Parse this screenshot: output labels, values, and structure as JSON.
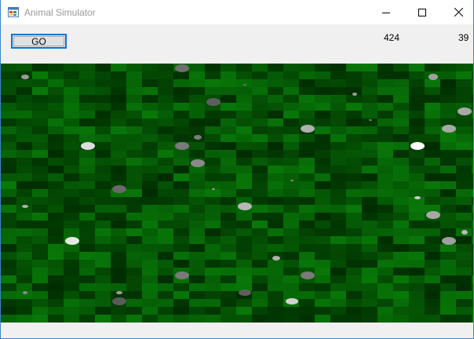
{
  "window": {
    "title": "Animal Simulator"
  },
  "toolbar": {
    "go_label": "GO"
  },
  "counters": {
    "left_value": "424",
    "right_value": "39"
  },
  "colors": {
    "accent": "#0078d7",
    "grass_base": "#004d00",
    "animal_light": "#e6e6e6",
    "animal_dark": "#6e6e6e"
  },
  "icons": {
    "app": "app-window-icon",
    "minimize": "minimize-icon",
    "maximize": "maximize-icon",
    "close": "close-icon"
  }
}
